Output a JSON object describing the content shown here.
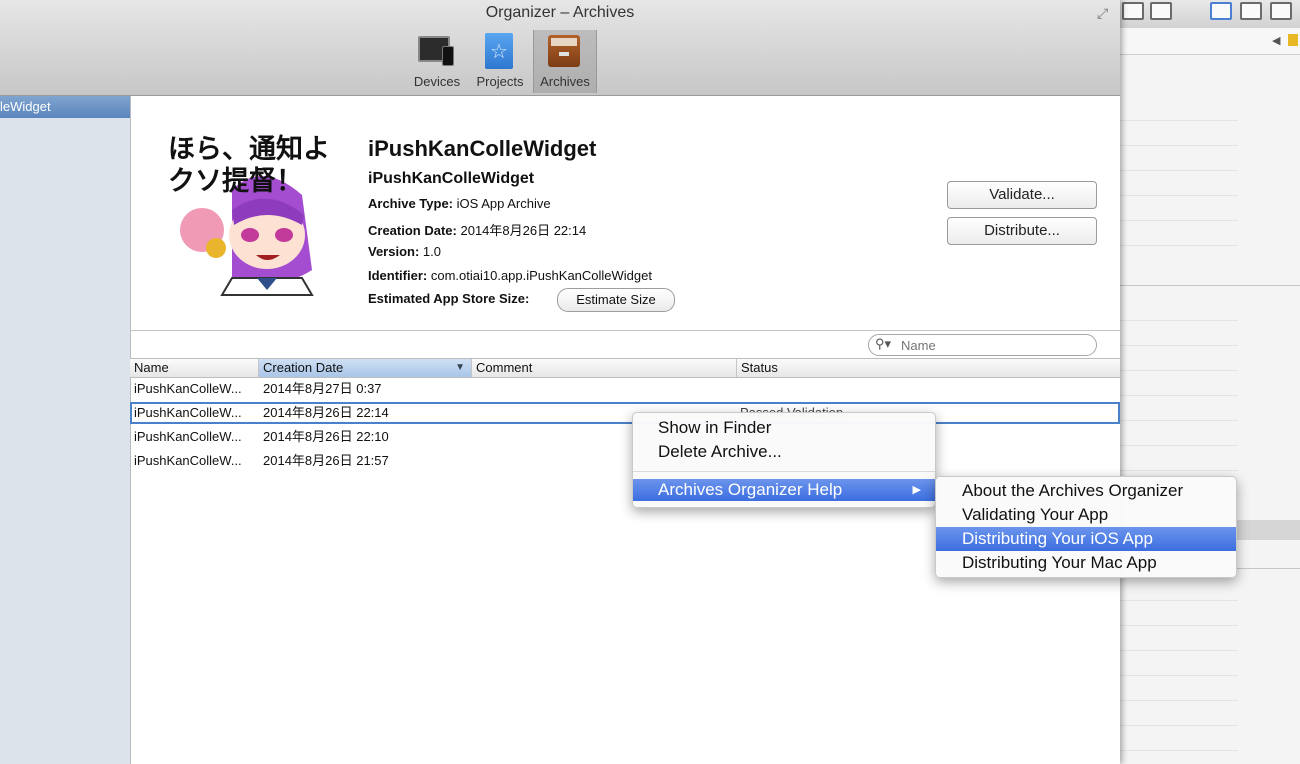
{
  "window": {
    "title": "Organizer – Archives",
    "toolbar": [
      {
        "label": "Devices",
        "icon": "devices-icon"
      },
      {
        "label": "Projects",
        "icon": "projects-icon"
      },
      {
        "label": "Archives",
        "icon": "archives-icon",
        "selected": true
      }
    ]
  },
  "sidebar": {
    "items": [
      {
        "label": "leWidget",
        "selected": true
      }
    ]
  },
  "archive": {
    "icon_caption": "ほら、通知よ\nクソ提督！",
    "name": "iPushKanColleWidget",
    "subname": "iPushKanColleWidget",
    "archive_type_label": "Archive Type:",
    "archive_type": "iOS App Archive",
    "creation_date_label": "Creation Date:",
    "creation_date": "2014年8月26日 22:14",
    "version_label": "Version:",
    "version": "1.0",
    "identifier_label": "Identifier:",
    "identifier": "com.otiai10.app.iPushKanColleWidget",
    "store_size_label": "Estimated App Store Size:",
    "estimate_button": "Estimate Size",
    "validate_button": "Validate...",
    "distribute_button": "Distribute..."
  },
  "search": {
    "placeholder": "Name"
  },
  "table": {
    "columns": [
      "Name",
      "Creation Date",
      "Comment",
      "Status"
    ],
    "sorted_column": "Creation Date",
    "rows": [
      {
        "name": "iPushKanColleW...",
        "date": "2014年8月27日 0:37",
        "comment": "",
        "status": ""
      },
      {
        "name": "iPushKanColleW...",
        "date": "2014年8月26日 22:14",
        "comment": "",
        "status": "Passed Validation",
        "selected": true
      },
      {
        "name": "iPushKanColleW...",
        "date": "2014年8月26日 22:10",
        "comment": "",
        "status": ""
      },
      {
        "name": "iPushKanColleW...",
        "date": "2014年8月26日 21:57",
        "comment": "",
        "status": ""
      }
    ]
  },
  "context_menu": {
    "items": [
      "Show in Finder",
      "Delete Archive...",
      "Archives Organizer Help"
    ],
    "highlighted": "Archives Organizer Help"
  },
  "submenu": {
    "items": [
      "About the Archives Organizer",
      "Validating Your App",
      "Distributing Your iOS App",
      "Distributing Your Mac App"
    ],
    "highlighted": "Distributing Your iOS App"
  },
  "colors": {
    "selection_blue": "#3c6ee0",
    "sidebar_selected": "#5a85bd",
    "row_border": "#4a82c9"
  }
}
